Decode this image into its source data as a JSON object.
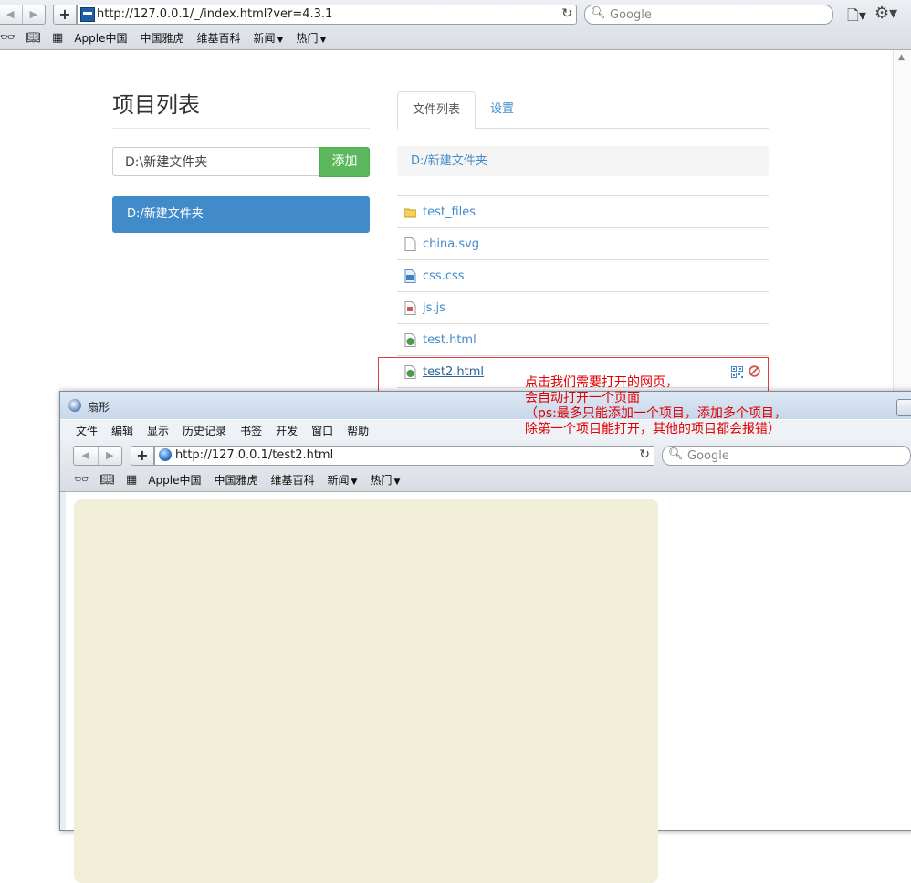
{
  "browser": {
    "nav": {
      "back": "◀",
      "forward": "▶"
    },
    "add_tab": "+",
    "url": "http://127.0.0.1/_/index.html?ver=4.3.1",
    "reload": "↻",
    "search_placeholder": "Google",
    "bookmarks": [
      {
        "label": "Apple中国"
      },
      {
        "label": "中国雅虎"
      },
      {
        "label": "维基百科"
      },
      {
        "label": "新闻",
        "dropdown": true
      },
      {
        "label": "热门",
        "dropdown": true
      }
    ]
  },
  "page": {
    "title": "项目列表",
    "path_input_value": "D:\\新建文件夹",
    "add_button": "添加",
    "projects": [
      {
        "label": "D:/新建文件夹"
      }
    ],
    "tabs": [
      {
        "label": "文件列表",
        "active": true
      },
      {
        "label": "设置",
        "active": false
      }
    ],
    "breadcrumb": "D:/新建文件夹",
    "files": [
      {
        "name": "test_files",
        "type": "folder"
      },
      {
        "name": "china.svg",
        "type": "file"
      },
      {
        "name": "css.css",
        "type": "css"
      },
      {
        "name": "js.js",
        "type": "js"
      },
      {
        "name": "test.html",
        "type": "html"
      },
      {
        "name": "test2.html",
        "type": "html",
        "highlighted": true
      }
    ]
  },
  "annotation": {
    "lines": [
      "点击我们需要打开的网页，",
      "会自动打开一个页面",
      "（ps:最多只能添加一个项目，添加多个项目，",
      "除第一个项目能打开，其他的项目都会报错）"
    ]
  },
  "popup": {
    "title": "扇形",
    "menu": [
      "文件",
      "编辑",
      "显示",
      "历史记录",
      "书签",
      "开发",
      "窗口",
      "帮助"
    ],
    "url": "http://127.0.0.1/test2.html",
    "search_placeholder": "Google",
    "bookmarks": [
      {
        "label": "Apple中国"
      },
      {
        "label": "中国雅虎"
      },
      {
        "label": "维基百科"
      },
      {
        "label": "新闻",
        "dropdown": true
      },
      {
        "label": "热门",
        "dropdown": true
      }
    ],
    "canvas_color": "#f1efd8"
  },
  "colors": {
    "primary": "#428bca",
    "success": "#5cb85c",
    "annotation": "#e00000"
  }
}
